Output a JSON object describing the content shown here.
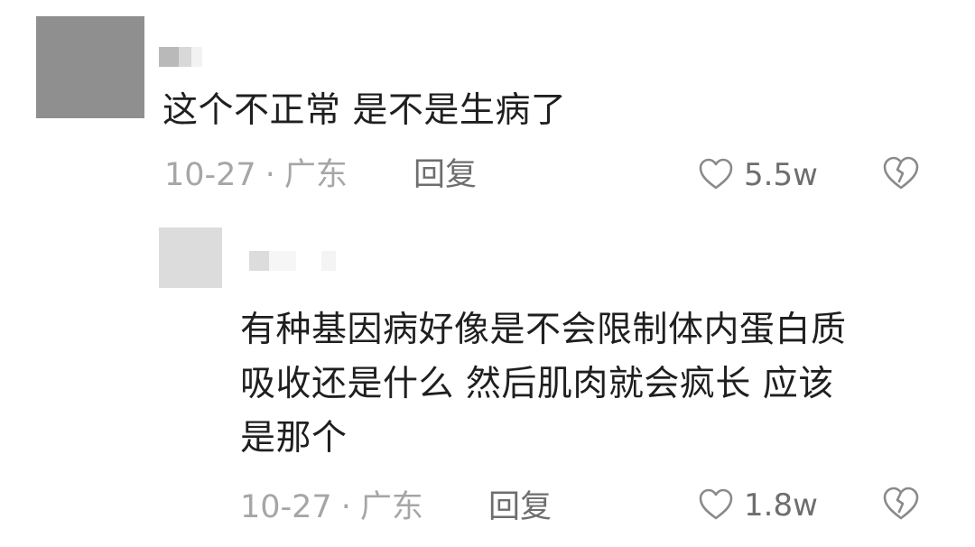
{
  "comments": [
    {
      "text": "这个不正常 是不是生病了",
      "date": "10-27",
      "separator": "·",
      "location": "广东",
      "reply_label": "回复",
      "likes": "5.5w"
    },
    {
      "text_lines": [
        "有种基因病好像是不会限制体内蛋白质",
        "吸收还是什么 然后肌肉就会疯长 应该",
        "是那个"
      ],
      "date": "10-27",
      "separator": "·",
      "location": "广东",
      "reply_label": "回复",
      "likes": "1.8w"
    }
  ],
  "icons": {
    "like": "heart-outline-icon",
    "dislike": "broken-heart-icon"
  },
  "colors": {
    "text": "#1f1f1f",
    "meta": "#a6a6a6",
    "action": "#6e6e6e",
    "icon": "#8a8a8a"
  }
}
